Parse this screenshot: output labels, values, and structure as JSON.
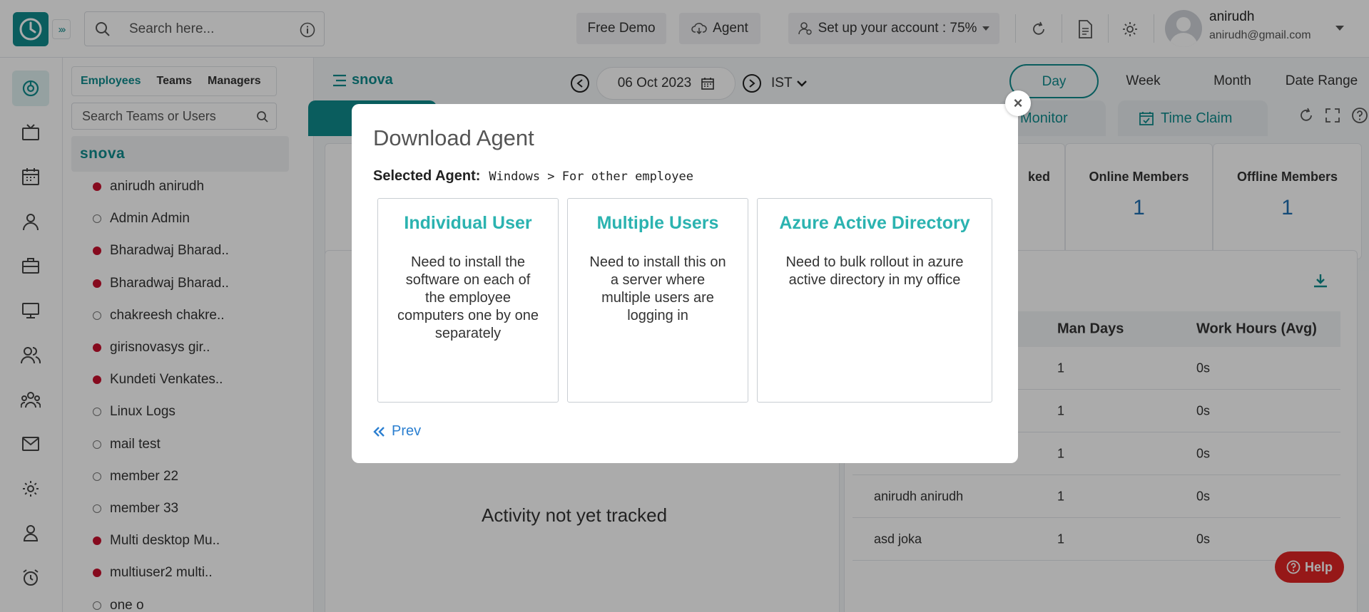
{
  "topbar": {
    "search_placeholder": "Search here...",
    "free_demo": "Free Demo",
    "agent": "Agent",
    "setup": "Set up your account : 75%",
    "user_name": "anirudh",
    "user_email": "anirudh@gmail.com"
  },
  "side": {
    "tabs": [
      "Employees",
      "Teams",
      "Managers"
    ],
    "search_placeholder": "Search Teams or Users",
    "group": "snova",
    "members": [
      {
        "name": "anirudh anirudh",
        "online": true
      },
      {
        "name": "Admin Admin",
        "online": false
      },
      {
        "name": "Bharadwaj Bharad..",
        "online": true
      },
      {
        "name": "Bharadwaj Bharad..",
        "online": true
      },
      {
        "name": "chakreesh chakre..",
        "online": false
      },
      {
        "name": "girisnovasys gir..",
        "online": true
      },
      {
        "name": "Kundeti Venkates..",
        "online": true
      },
      {
        "name": "Linux Logs",
        "online": false
      },
      {
        "name": "mail test",
        "online": false
      },
      {
        "name": "member 22",
        "online": false
      },
      {
        "name": "member 33",
        "online": false
      },
      {
        "name": "Multi desktop Mu..",
        "online": true
      },
      {
        "name": "multiuser2 multi..",
        "online": true
      },
      {
        "name": "one o",
        "online": false
      }
    ]
  },
  "main": {
    "title": "snova",
    "date": "06 Oct 2023",
    "timezone": "IST",
    "ranges": [
      "Day",
      "Week",
      "Month",
      "Date Range"
    ],
    "tabs": {
      "monitor": "Monitor",
      "time_claim": "Time Claim"
    },
    "stats": {
      "tracked_partial": "ked",
      "online_label": "Online Members",
      "online_value": "1",
      "offline_label": "Offline Members",
      "offline_value": "1"
    },
    "no_activity": "Activity not yet tracked",
    "table": {
      "headers": [
        "Man Days",
        "Work Hours (Avg)"
      ],
      "rows": [
        {
          "name": "",
          "days": "1",
          "hours": "0s"
        },
        {
          "name": "",
          "days": "1",
          "hours": "0s"
        },
        {
          "name": "",
          "days": "1",
          "hours": "0s"
        },
        {
          "name": "anirudh anirudh",
          "days": "1",
          "hours": "0s"
        },
        {
          "name": "asd joka",
          "days": "1",
          "hours": "0s"
        }
      ]
    },
    "help": "Help"
  },
  "modal": {
    "title": "Download Agent",
    "selected_label": "Selected Agent:",
    "selected_value": "Windows > For other employee",
    "options": [
      {
        "title": "Individual User",
        "desc": "Need to install the software on each of the employee computers one by one separately"
      },
      {
        "title": "Multiple Users",
        "desc": "Need to install this on a server where multiple users are logging in"
      },
      {
        "title": "Azure Active Directory",
        "desc": "Need to bulk rollout in azure active directory in my office"
      }
    ],
    "prev": "Prev"
  },
  "colors": {
    "accent": "#0f8b8d",
    "option_title": "#2bb3b0",
    "online_dot": "#c8102e",
    "help": "#e02424"
  }
}
